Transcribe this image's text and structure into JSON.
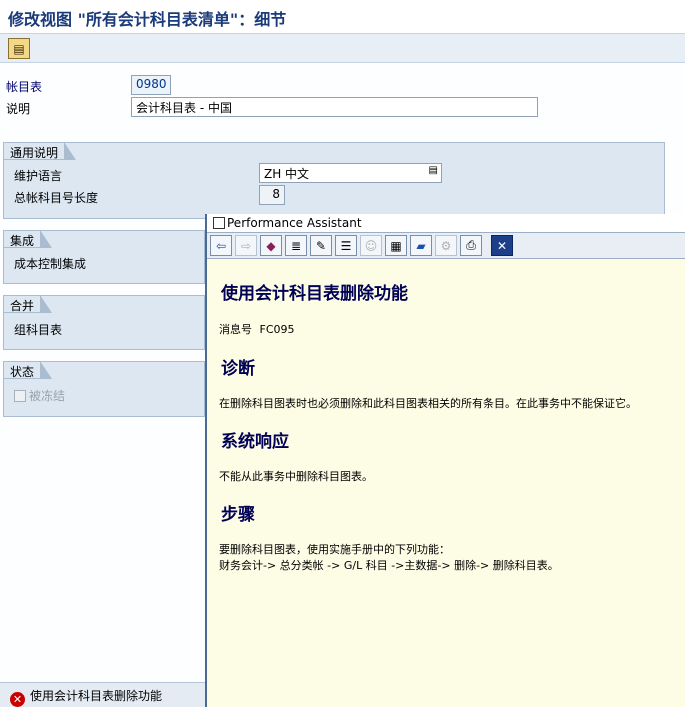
{
  "window": {
    "title": "修改视图 \"所有会计科目表清单\"：细节"
  },
  "appbar": {
    "icon": "expand-detail-icon"
  },
  "fields": {
    "chart_of_accounts": {
      "label": "帐目表",
      "value": "0980"
    },
    "description": {
      "label": "说明",
      "value": "会计科目表 - 中国"
    }
  },
  "groups": {
    "general": {
      "title": "通用说明",
      "maint_language_label": "维护语言",
      "maint_language_value": "ZH 中文",
      "gl_length_label": "总帐科目号长度",
      "gl_length_value": "8"
    },
    "integration": {
      "title": "集成",
      "item": "成本控制集成"
    },
    "consolidation": {
      "title": "合并",
      "item": "组科目表"
    },
    "status": {
      "title": "状态",
      "checkbox_label": "被冻结"
    }
  },
  "statusbar": {
    "message": "使用会计科目表删除功能"
  },
  "assistant": {
    "title": "Performance Assistant",
    "heading": "使用会计科目表删除功能",
    "message_no_label": "消息号",
    "message_no": "FC095",
    "diag_heading": "诊断",
    "diag_text": "在删除科目图表时也必须删除和此科目图表相关的所有条目。在此事务中不能保证它。",
    "sys_heading": "系统响应",
    "sys_text": "不能从此事务中删除科目图表。",
    "steps_heading": "步骤",
    "steps_line1": "要删除科目图表，使用实施手册中的下列功能：",
    "steps_line2": "财务会计->  总分类帐  -> G/L 科目  ->主数据-> 删除-> 删除科目表。"
  }
}
